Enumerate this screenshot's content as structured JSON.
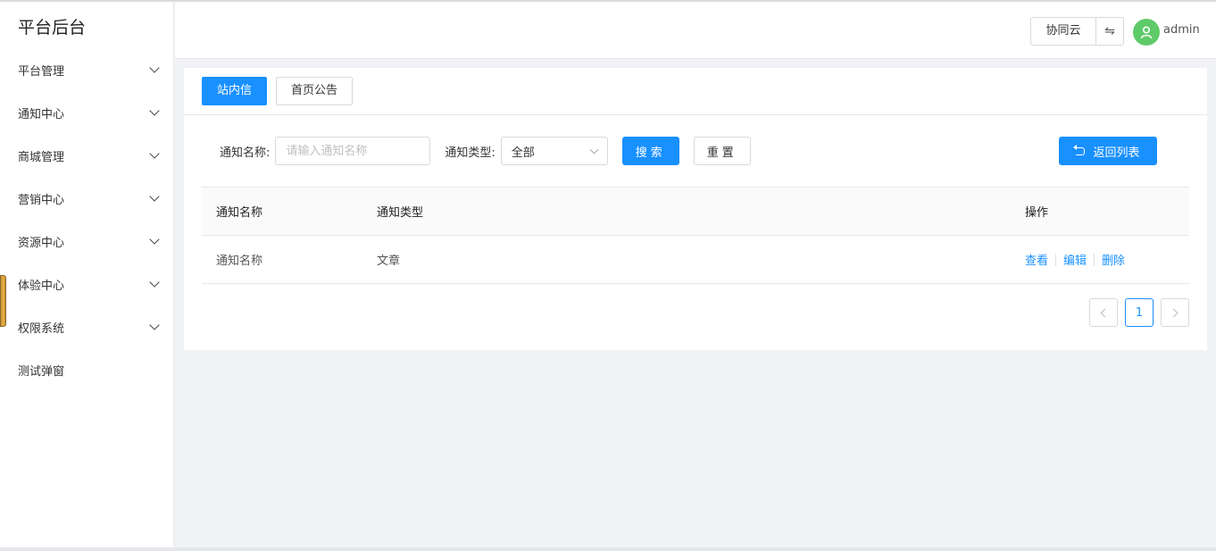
{
  "sidebar": {
    "logo": "平台后台",
    "items": [
      {
        "label": "平台管理",
        "has_children": true
      },
      {
        "label": "通知中心",
        "has_children": true
      },
      {
        "label": "商城管理",
        "has_children": true
      },
      {
        "label": "营销中心",
        "has_children": true
      },
      {
        "label": "资源中心",
        "has_children": true
      },
      {
        "label": "体验中心",
        "has_children": true
      },
      {
        "label": "权限系统",
        "has_children": true
      },
      {
        "label": "测试弹窗",
        "has_children": false
      }
    ]
  },
  "header": {
    "collab_label": "协同云",
    "swap_icon": "⇋",
    "username": "admin"
  },
  "tabs": [
    {
      "label": "站内信",
      "active": true
    },
    {
      "label": "首页公告",
      "active": false
    }
  ],
  "filter": {
    "name_label": "通知名称:",
    "name_placeholder": "请输入通知名称",
    "type_label": "通知类型:",
    "type_value": "全部",
    "search_label": "搜索",
    "reset_label": "重置",
    "back_label": "返回列表"
  },
  "table": {
    "columns": [
      "通知名称",
      "通知类型",
      "操作"
    ],
    "rows": [
      {
        "name": "通知名称",
        "type": "文章",
        "actions": [
          "查看",
          "编辑",
          "删除"
        ]
      }
    ]
  },
  "pagination": {
    "current": "1"
  },
  "colors": {
    "primary": "#1890ff",
    "avatar": "#5fca6a"
  }
}
